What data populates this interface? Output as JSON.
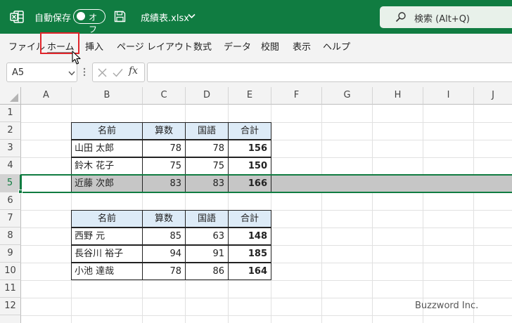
{
  "titlebar": {
    "autosave_label": "自動保存",
    "autosave_state": "オフ",
    "filename": "成績表.xlsx",
    "search_text": "検索 (Alt+Q)",
    "bg_color": "#107c41"
  },
  "ribbon": {
    "tabs": [
      "ファイル",
      "ホーム",
      "挿入",
      "ページ レイアウト",
      "数式",
      "データ",
      "校閲",
      "表示",
      "ヘルプ"
    ]
  },
  "formula_bar": {
    "cell_ref": "A5",
    "fx_label": "fx",
    "formula": ""
  },
  "grid": {
    "columns": [
      "A",
      "B",
      "C",
      "D",
      "E",
      "F",
      "G",
      "H",
      "I",
      "J"
    ],
    "rows": [
      "1",
      "2",
      "3",
      "4",
      "5",
      "6",
      "7",
      "8",
      "9",
      "10",
      "11",
      "12"
    ],
    "selected_row": "5"
  },
  "table1": {
    "headers": [
      "名前",
      "算数",
      "国語",
      "合計"
    ],
    "rows": [
      [
        "山田 太郎",
        "78",
        "78",
        "156"
      ],
      [
        "鈴木 花子",
        "75",
        "75",
        "150"
      ],
      [
        "近藤 次郎",
        "83",
        "83",
        "166"
      ]
    ]
  },
  "table2": {
    "headers": [
      "名前",
      "算数",
      "国語",
      "合計"
    ],
    "rows": [
      [
        "西野 元",
        "85",
        "63",
        "148"
      ],
      [
        "長谷川 裕子",
        "94",
        "91",
        "185"
      ],
      [
        "小池 達哉",
        "78",
        "86",
        "164"
      ]
    ]
  },
  "watermark": "Buzzword Inc."
}
